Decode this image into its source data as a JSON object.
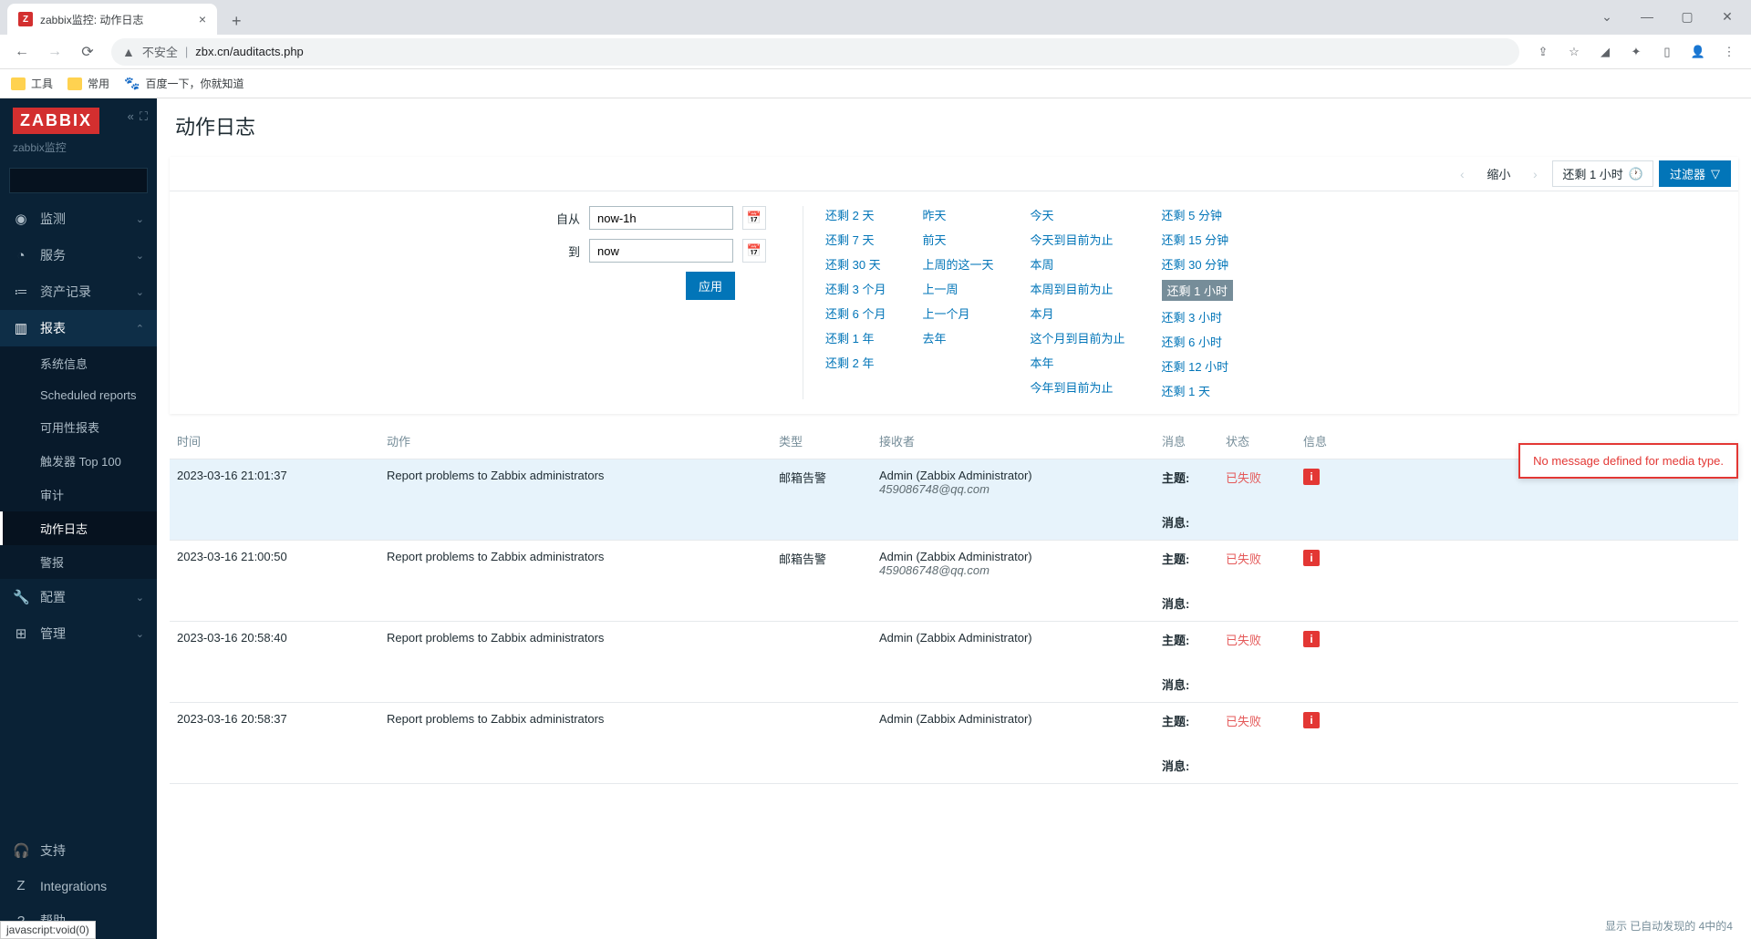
{
  "browser": {
    "tab_title": "zabbix监控: 动作日志",
    "url_warn": "不安全",
    "url": "zbx.cn/auditacts.php",
    "bookmarks": [
      "工具",
      "常用",
      "百度一下，你就知道"
    ]
  },
  "sidebar": {
    "logo": "ZABBIX",
    "subtitle": "zabbix监控",
    "menu": [
      {
        "icon": "◉",
        "label": "监测",
        "expandable": true
      },
      {
        "icon": "◔",
        "label": "服务",
        "expandable": true
      },
      {
        "icon": "≔",
        "label": "资产记录",
        "expandable": true
      },
      {
        "icon": "▥",
        "label": "报表",
        "expandable": true,
        "expanded": true,
        "children": [
          {
            "label": "系统信息"
          },
          {
            "label": "Scheduled reports"
          },
          {
            "label": "可用性报表"
          },
          {
            "label": "触发器 Top 100"
          },
          {
            "label": "审计"
          },
          {
            "label": "动作日志",
            "active": true
          },
          {
            "label": "警报"
          }
        ]
      },
      {
        "icon": "🔧",
        "label": "配置",
        "expandable": true
      },
      {
        "icon": "⊞",
        "label": "管理",
        "expandable": true
      }
    ],
    "bottom": [
      {
        "icon": "🎧",
        "label": "支持"
      },
      {
        "icon": "Z",
        "label": "Integrations"
      },
      {
        "icon": "?",
        "label": "帮助"
      }
    ]
  },
  "page": {
    "title": "动作日志",
    "filter": {
      "zoom_out": "缩小",
      "time_range": "还剩 1 小时",
      "filter_btn": "过滤器",
      "from_label": "自从",
      "from_value": "now-1h",
      "to_label": "到",
      "to_value": "now",
      "apply": "应用",
      "presets": {
        "col1": [
          "还剩 2 天",
          "还剩 7 天",
          "还剩 30 天",
          "还剩 3 个月",
          "还剩 6 个月",
          "还剩 1 年",
          "还剩 2 年"
        ],
        "col2": [
          "昨天",
          "前天",
          "上周的这一天",
          "上一周",
          "上一个月",
          "去年"
        ],
        "col3": [
          "今天",
          "今天到目前为止",
          "本周",
          "本周到目前为止",
          "本月",
          "这个月到目前为止",
          "本年",
          "今年到目前为止"
        ],
        "col4": [
          "还剩 5 分钟",
          "还剩 15 分钟",
          "还剩 30 分钟",
          "还剩 1 小时",
          "还剩 3 小时",
          "还剩 6 小时",
          "还剩 12 小时",
          "还剩 1 天"
        ]
      },
      "selected_preset": "还剩 1 小时"
    },
    "table": {
      "headers": {
        "time": "时间",
        "action": "动作",
        "type": "类型",
        "recipient": "接收者",
        "message": "消息",
        "status": "状态",
        "info": "信息"
      },
      "msg_subject": "主题:",
      "msg_body": "消息:",
      "rows": [
        {
          "time": "2023-03-16 21:01:37",
          "action": "Report problems to Zabbix administrators",
          "type": "邮箱告警",
          "recipient_name": "Admin (Zabbix Administrator)",
          "recipient_email": "459086748@qq.com",
          "status": "已失败",
          "highlight": true
        },
        {
          "time": "2023-03-16 21:00:50",
          "action": "Report problems to Zabbix administrators",
          "type": "邮箱告警",
          "recipient_name": "Admin (Zabbix Administrator)",
          "recipient_email": "459086748@qq.com",
          "status": "已失败"
        },
        {
          "time": "2023-03-16 20:58:40",
          "action": "Report problems to Zabbix administrators",
          "type": "",
          "recipient_name": "Admin (Zabbix Administrator)",
          "recipient_email": "",
          "status": "已失败"
        },
        {
          "time": "2023-03-16 20:58:37",
          "action": "Report problems to Zabbix administrators",
          "type": "",
          "recipient_name": "Admin (Zabbix Administrator)",
          "recipient_email": "",
          "status": "已失败"
        }
      ]
    },
    "tooltip": "No message defined for media type.",
    "footer": "显示 已自动发现的 4中的4",
    "status_bar": "javascript:void(0)"
  }
}
